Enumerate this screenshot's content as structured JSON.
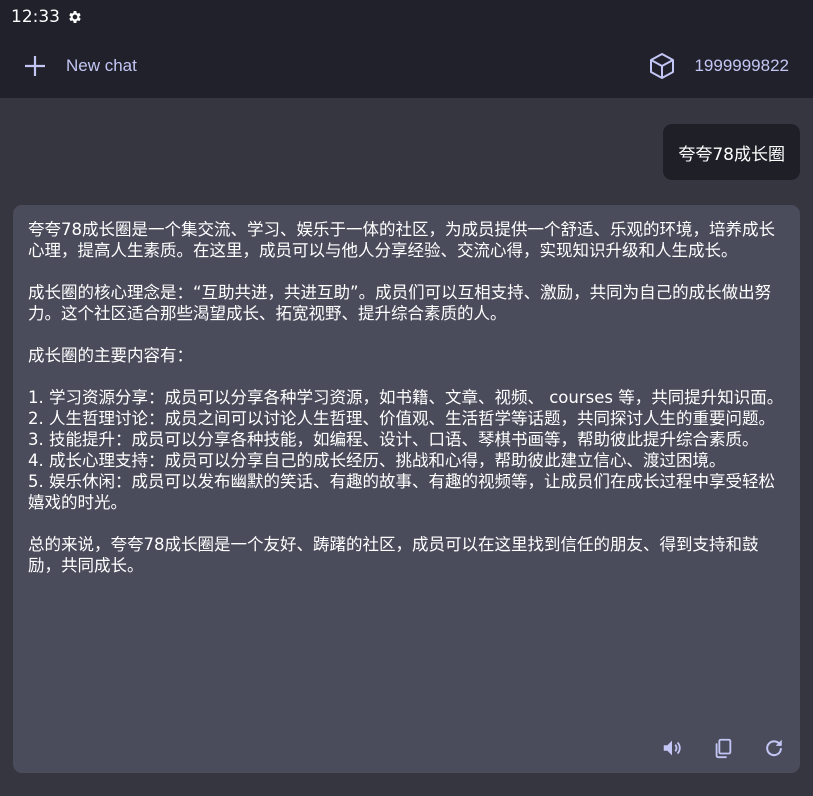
{
  "status_bar": {
    "time": "12:33",
    "settings_icon": "gear-icon"
  },
  "header": {
    "new_chat_label": "New chat",
    "new_chat_icon": "plus-icon",
    "account_label": "1999999822",
    "account_icon": "cube-icon",
    "accent_color": "#c3c6f5"
  },
  "conversation": {
    "user_message": "夸夸78成长圈",
    "assistant_message": {
      "paragraphs": [
        "夸夸78成长圈是一个集交流、学习、娱乐于一体的社区，为成员提供一个舒适、乐观的环境，培养成长心理，提高人生素质。在这里，成员可以与他人分享经验、交流心得，实现知识升级和人生成长。",
        "",
        "成长圈的核心理念是：“互助共进，共进互助”。成员们可以互相支持、激励，共同为自己的成长做出努力。这个社区适合那些渴望成长、拓宽视野、提升综合素质的人。",
        "",
        "成长圈的主要内容有：",
        "",
        "1. 学习资源分享：成员可以分享各种学习资源，如书籍、文章、视频、 courses 等，共同提升知识面。",
        "2. 人生哲理讨论：成员之间可以讨论人生哲理、价值观、生活哲学等话题，共同探讨人生的重要问题。",
        "3. 技能提升：成员可以分享各种技能，如编程、设计、口语、琴棋书画等，帮助彼此提升综合素质。",
        "4. 成长心理支持：成员可以分享自己的成长经历、挑战和心得，帮助彼此建立信心、渡过困境。",
        "5. 娱乐休闲：成员可以发布幽默的笑话、有趣的故事、有趣的视频等，让成员们在成长过程中享受轻松嬉戏的时光。",
        "",
        "总的来说，夸夸78成长圈是一个友好、踌躇的社区，成员可以在这里找到信任的朋友、得到支持和鼓励，共同成长。"
      ]
    },
    "actions": [
      "speaker-icon",
      "copy-icon",
      "refresh-icon"
    ]
  }
}
